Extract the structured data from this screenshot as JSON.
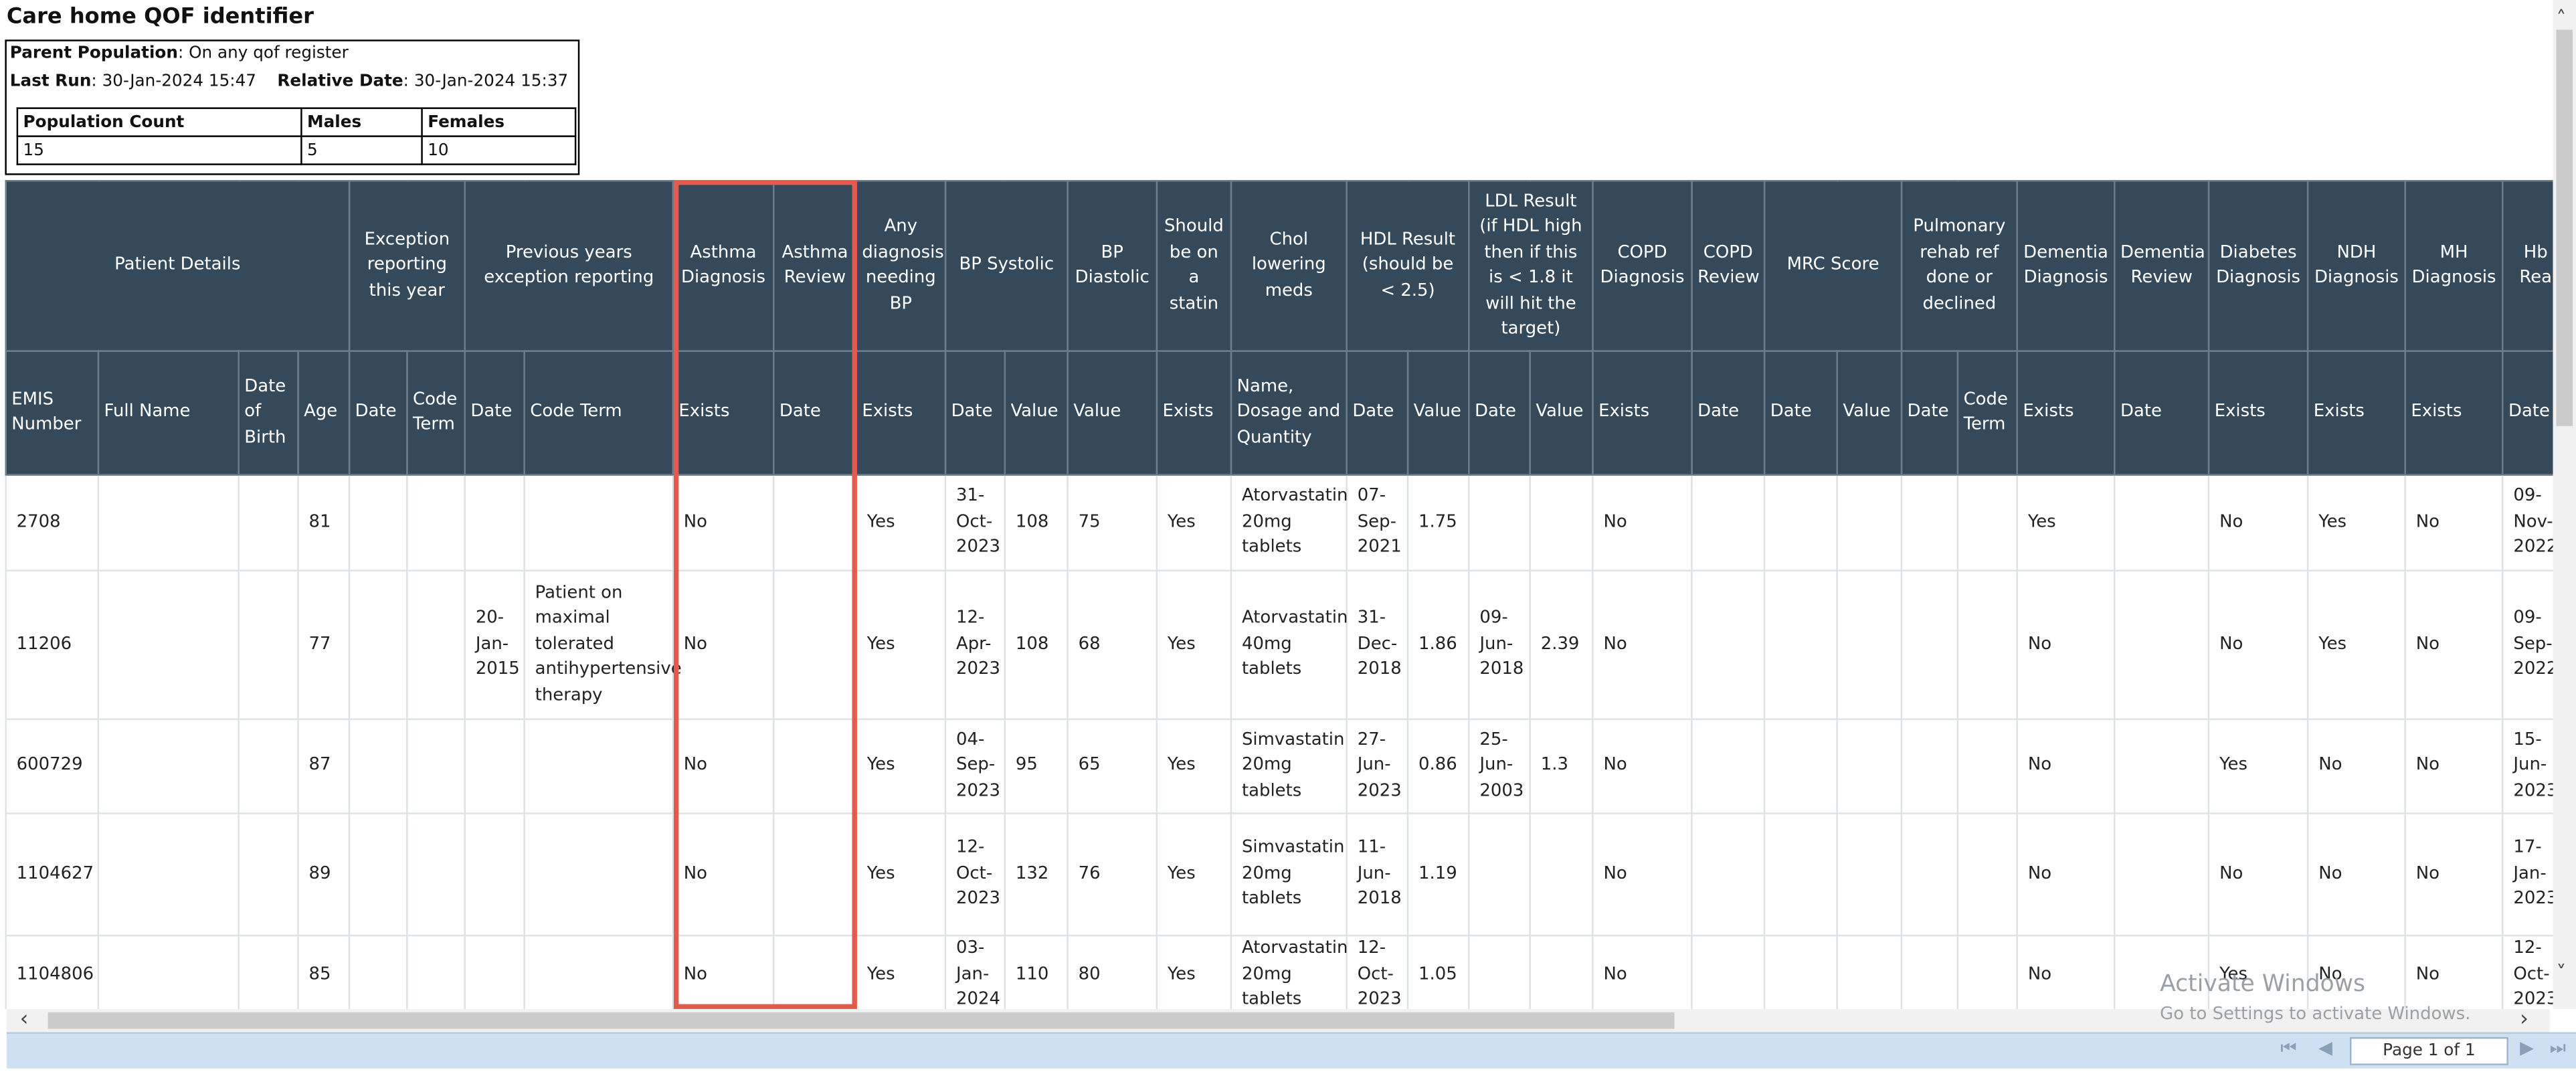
{
  "report": {
    "title": "Care home QOF identifier",
    "parent_population_label": "Parent Population",
    "parent_population_value": ": On any qof register",
    "last_run_label": "Last Run",
    "last_run_value": ": 30-Jan-2024 15:47",
    "relative_date_label": "Relative Date",
    "relative_date_value": ": 30-Jan-2024 15:37",
    "population_table": {
      "headers": [
        "Population Count",
        "Males",
        "Females"
      ],
      "values": [
        "15",
        "5",
        "10"
      ]
    }
  },
  "grid": {
    "group_headers": [
      "Patient Details",
      "Exception reporting this year",
      "Previous years exception reporting",
      "Asthma Diagnosis",
      "Asthma Review",
      "Any diagnosis needing BP",
      "BP Systolic",
      "BP Diastolic",
      "Should be on a statin",
      "Chol lowering meds",
      "HDL Result (should be < 2.5)",
      "LDL Result (if HDL high then if this is < 1.8 it will hit the target)",
      "COPD Diagnosis",
      "COPD Review",
      "MRC Score",
      "Pulmonary rehab ref done or declined",
      "Dementia Diagnosis",
      "Dementia Review",
      "Diabetes Diagnosis",
      "NDH Diagnosis",
      "MH Diagnosis",
      "Hb Rea"
    ],
    "sub_headers": [
      "EMIS Number",
      "Full Name",
      "Date of Birth",
      "Age",
      "Date",
      "Code Term",
      "Date",
      "Code Term",
      "Exists",
      "Date",
      "Exists",
      "Date",
      "Value",
      "Value",
      "Exists",
      "Name, Dosage and Quantity",
      "Date",
      "Value",
      "Date",
      "Value",
      "Exists",
      "Date",
      "Date",
      "Value",
      "Date",
      "Code Term",
      "Exists",
      "Date",
      "Exists",
      "Exists",
      "Exists",
      "Date"
    ],
    "rows": [
      [
        "2708",
        "",
        "",
        "81",
        "",
        "",
        "",
        "",
        "No",
        "",
        "Yes",
        "31-Oct-2023",
        "108",
        "75",
        "Yes",
        "Atorvastatin 20mg tablets",
        "07-Sep-2021",
        "1.75",
        "",
        "",
        "No",
        "",
        "",
        "",
        "",
        "",
        "Yes",
        "",
        "No",
        "Yes",
        "No",
        "09-Nov-2022"
      ],
      [
        "11206",
        "",
        "",
        "77",
        "",
        "",
        "20-Jan-2015",
        "Patient on maximal tolerated antihypertensive therapy",
        "No",
        "",
        "Yes",
        "12-Apr-2023",
        "108",
        "68",
        "Yes",
        "Atorvastatin 40mg tablets",
        "31-Dec-2018",
        "1.86",
        "09-Jun-2018",
        "2.39",
        "No",
        "",
        "",
        "",
        "",
        "",
        "No",
        "",
        "No",
        "Yes",
        "No",
        "09-Sep-2022"
      ],
      [
        "600729",
        "",
        "",
        "87",
        "",
        "",
        "",
        "",
        "No",
        "",
        "Yes",
        "04-Sep-2023",
        "95",
        "65",
        "Yes",
        "Simvastatin 20mg tablets",
        "27-Jun-2023",
        "0.86",
        "25-Jun-2003",
        "1.3",
        "No",
        "",
        "",
        "",
        "",
        "",
        "No",
        "",
        "Yes",
        "No",
        "No",
        "15-Jun-2023"
      ],
      [
        "1104627",
        "",
        "",
        "89",
        "",
        "",
        "",
        "",
        "No",
        "",
        "Yes",
        "12-Oct-2023",
        "132",
        "76",
        "Yes",
        "Simvastatin 20mg tablets",
        "11-Jun-2018",
        "1.19",
        "",
        "",
        "No",
        "",
        "",
        "",
        "",
        "",
        "No",
        "",
        "No",
        "No",
        "No",
        "17-Jan-2023"
      ],
      [
        "1104806",
        "",
        "",
        "85",
        "",
        "",
        "",
        "",
        "No",
        "",
        "Yes",
        "03-Jan-2024",
        "110",
        "80",
        "Yes",
        "Atorvastatin 20mg tablets",
        "12-Oct-2023",
        "1.05",
        "",
        "",
        "No",
        "",
        "",
        "",
        "",
        "",
        "No",
        "",
        "Yes",
        "No",
        "No",
        "12-Oct-2023"
      ]
    ]
  },
  "pager": {
    "label": "Page 1 of 1"
  },
  "watermark": {
    "line1": "Activate Windows",
    "line2": "Go to Settings to activate Windows."
  },
  "colors": {
    "header_bg": "#34495a",
    "highlight": "#e35b4f",
    "footer_bg": "#cfe0f3"
  }
}
